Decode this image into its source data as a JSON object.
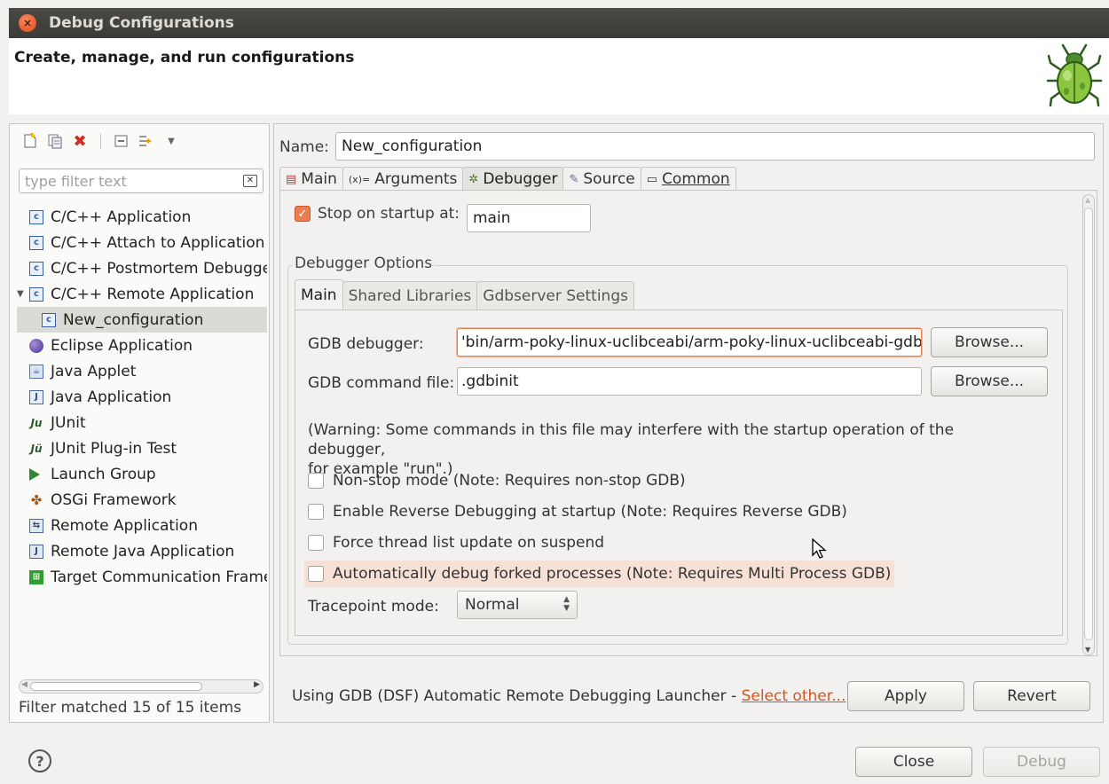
{
  "window": {
    "title": "Debug Configurations",
    "heading": "Create, manage, and run configurations"
  },
  "left": {
    "toolbar": [
      "new-config-icon",
      "duplicate-icon",
      "delete-icon",
      "collapse-all-icon",
      "filter-icon",
      "dropdown-icon"
    ],
    "filter_placeholder": "type filter text",
    "items": [
      {
        "label": "C/C++ Application",
        "icon": "c-icon"
      },
      {
        "label": "C/C++ Attach to Application",
        "icon": "c-icon"
      },
      {
        "label": "C/C++ Postmortem Debugger",
        "icon": "c-icon"
      },
      {
        "label": "C/C++ Remote Application",
        "icon": "c-icon",
        "expanded": true
      },
      {
        "label": "New_configuration",
        "icon": "c-icon",
        "selected": true
      },
      {
        "label": "Eclipse Application",
        "icon": "eclipse-icon"
      },
      {
        "label": "Java Applet",
        "icon": "applet-icon"
      },
      {
        "label": "Java Application",
        "icon": "java-app-icon"
      },
      {
        "label": "JUnit",
        "icon": "junit-icon"
      },
      {
        "label": "JUnit Plug-in Test",
        "icon": "junit-plugin-icon"
      },
      {
        "label": "Launch Group",
        "icon": "launch-icon"
      },
      {
        "label": "OSGi Framework",
        "icon": "osgi-icon"
      },
      {
        "label": "Remote Application",
        "icon": "remote-icon"
      },
      {
        "label": "Remote Java Application",
        "icon": "remote-java-icon"
      },
      {
        "label": "Target Communication Framework",
        "icon": "tcf-icon"
      }
    ],
    "status": "Filter matched 15 of 15 items"
  },
  "right": {
    "name_label": "Name:",
    "name_value": "New_configuration",
    "tabs": [
      {
        "label": "Main",
        "icon": "main-tab-icon"
      },
      {
        "label": "Arguments",
        "icon": "arguments-icon"
      },
      {
        "label": "Debugger",
        "icon": "debugger-icon",
        "active": true
      },
      {
        "label": "Source",
        "icon": "source-icon"
      },
      {
        "label": "Common",
        "icon": "common-icon"
      }
    ],
    "stop_on_startup_label": "Stop on startup at:",
    "stop_on_startup_checked": true,
    "stop_on_startup_value": "main",
    "group_title": "Debugger Options",
    "inner_tabs": [
      "Main",
      "Shared Libraries",
      "Gdbserver Settings"
    ],
    "gdb_debugger_label": "GDB debugger:",
    "gdb_debugger_value": "'bin/arm-poky-linux-uclibceabi/arm-poky-linux-uclibceabi-gdb",
    "gdb_command_label": "GDB command file:",
    "gdb_command_value": ".gdbinit",
    "browse_label": "Browse...",
    "warning_line1": "(Warning: Some commands in this file may interfere with the startup operation of the debugger,",
    "warning_line2": "for example \"run\".)",
    "options": [
      {
        "label": "Non-stop mode (Note: Requires non-stop GDB)",
        "checked": false
      },
      {
        "label": "Enable Reverse Debugging at startup (Note: Requires Reverse GDB)",
        "checked": false
      },
      {
        "label": "Force thread list update on suspend",
        "checked": false
      },
      {
        "label": "Automatically debug forked processes (Note: Requires Multi Process GDB)",
        "checked": false
      }
    ],
    "tracepoint_label": "Tracepoint mode:",
    "tracepoint_value": "Normal",
    "launcher_text": "Using GDB (DSF) Automatic Remote Debugging Launcher - ",
    "select_other": "Select other...",
    "apply": "Apply",
    "revert": "Revert"
  },
  "footer": {
    "close": "Close",
    "debug": "Debug"
  },
  "colors": {
    "accent": "#e97f4f",
    "link": "#d9531e",
    "titlebar": "#3c3b37"
  }
}
